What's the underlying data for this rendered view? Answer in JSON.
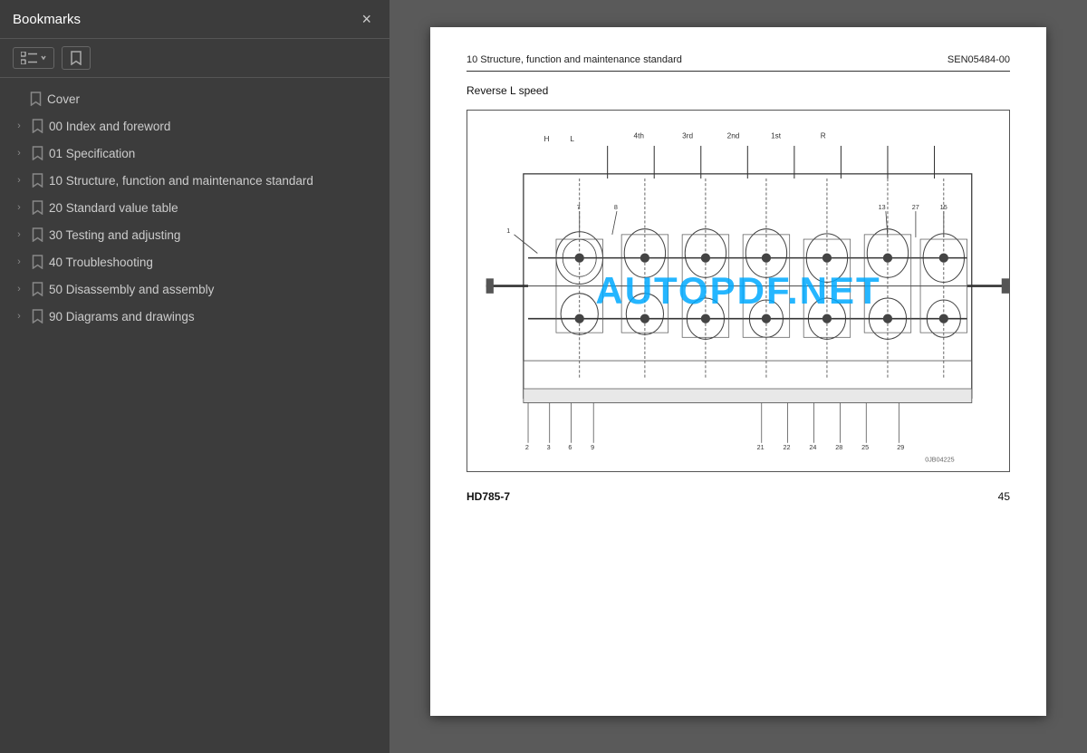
{
  "sidebar": {
    "title": "Bookmarks",
    "close_label": "×",
    "toolbar": {
      "list_icon": "list-icon",
      "bookmark_add_icon": "bookmark-add-icon"
    },
    "items": [
      {
        "id": "cover",
        "label": "Cover",
        "has_chevron": false
      },
      {
        "id": "00",
        "label": "00 Index and foreword",
        "has_chevron": true
      },
      {
        "id": "01",
        "label": "01 Specification",
        "has_chevron": true
      },
      {
        "id": "10",
        "label": "10 Structure, function and maintenance standard",
        "has_chevron": true
      },
      {
        "id": "20",
        "label": "20 Standard value table",
        "has_chevron": true
      },
      {
        "id": "30",
        "label": "30 Testing and adjusting",
        "has_chevron": true
      },
      {
        "id": "40",
        "label": "40 Troubleshooting",
        "has_chevron": true
      },
      {
        "id": "50",
        "label": "50 Disassembly and assembly",
        "has_chevron": true
      },
      {
        "id": "90",
        "label": "90 Diagrams and drawings",
        "has_chevron": true
      }
    ]
  },
  "page": {
    "header_left": "10 Structure, function and maintenance standard",
    "header_right": "SEN05484-00",
    "section_label": "Reverse L speed",
    "watermark": "AUTOPDF.NET",
    "footer_model": "HD785-7",
    "footer_page": "45",
    "diagram_code": "0JB04225"
  }
}
